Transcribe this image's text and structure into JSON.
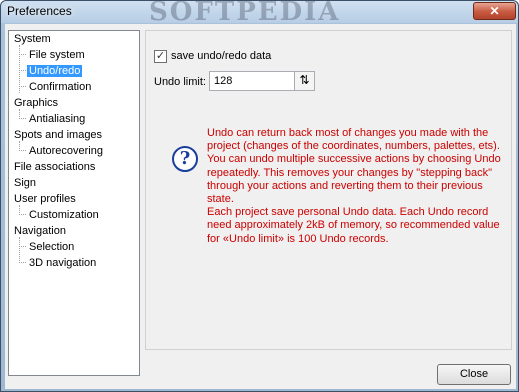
{
  "window": {
    "title": "Preferences",
    "watermark": "SOFTPEDIA",
    "close_glyph": "✕"
  },
  "tree": {
    "items": [
      {
        "label": "System",
        "level": 0
      },
      {
        "label": "File system",
        "level": 1
      },
      {
        "label": "Undo/redo",
        "level": 1,
        "selected": true
      },
      {
        "label": "Confirmation",
        "level": 1
      },
      {
        "label": "Graphics",
        "level": 0
      },
      {
        "label": "Antialiasing",
        "level": 1
      },
      {
        "label": "Spots and images",
        "level": 0
      },
      {
        "label": "Autorecovering",
        "level": 1
      },
      {
        "label": "File associations",
        "level": 0
      },
      {
        "label": "Sign",
        "level": 0
      },
      {
        "label": "User profiles",
        "level": 0
      },
      {
        "label": "Customization",
        "level": 1
      },
      {
        "label": "Navigation",
        "level": 0
      },
      {
        "label": "Selection",
        "level": 1
      },
      {
        "label": "3D navigation",
        "level": 1
      }
    ]
  },
  "undo": {
    "checkbox_label": "save undo/redo data",
    "checkbox_checked": true,
    "checkbox_glyph": "✓",
    "limit_label": "Undo limit:",
    "limit_value": "128",
    "spin_glyph": "⇅",
    "help_icon": "?",
    "help_paragraphs": [
      "Undo can return back most of changes you made with the project (changes of the coordinates, numbers, palettes, ets).",
      "You can undo multiple successive actions by choosing Undo repeatedly. This removes your changes by \"stepping back\" through your actions and reverting them to their previous state.",
      "Each project save personal Undo data. Each Undo record need approximately 2kB of memory, so recommended value for «Undo limit» is 100 Undo records."
    ]
  },
  "footer": {
    "close_label": "Close"
  }
}
